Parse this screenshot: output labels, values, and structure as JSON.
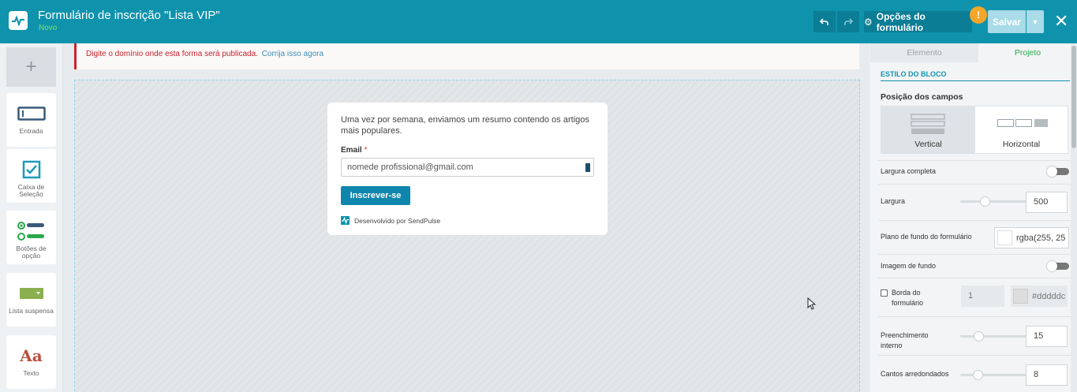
{
  "header": {
    "title": "Formulário de inscrição \"Lista VIP\"",
    "status": "Novo",
    "options_label": "Opções do formulário",
    "save_label": "Salvar"
  },
  "sidebar": {
    "add_label": "+",
    "items": [
      {
        "label": "Entrada",
        "icon": "input-field-icon"
      },
      {
        "label": "Caixa de Seleção",
        "icon": "checkbox-icon"
      },
      {
        "label": "Botões de opção",
        "icon": "radio-buttons-icon"
      },
      {
        "label": "Lista suspensa",
        "icon": "dropdown-list-icon"
      },
      {
        "label": "Texto",
        "icon": "text-icon",
        "glyph": "Aa"
      }
    ]
  },
  "notice": {
    "message": "Digite o domínio onde esta forma será publicada.",
    "link": "Corrija isso agora"
  },
  "form": {
    "description": "Uma vez por semana, enviamos um resumo contendo os artigos mais populares.",
    "email_label": "Email",
    "required_mark": "*",
    "email_placeholder": "nomede profissional@gmail.com",
    "button_label": "Inscrever-se",
    "powered_by": "Desenvolvido por SendPulse"
  },
  "panel": {
    "tabs": [
      "Elemento",
      "Projeto"
    ],
    "active_tab": "Projeto",
    "section_title": "ESTILO DO BLOCO",
    "position_title": "Posição dos campos",
    "position_options": [
      "Vertical",
      "Horizontal"
    ],
    "position_selected": "Vertical",
    "full_width_label": "Largura completa",
    "full_width_on": false,
    "width_label": "Largura",
    "width_value": "500",
    "bg_label": "Plano de fundo do formulário",
    "bg_value": "rgba(255, 25",
    "bg_image_label": "Imagem de fundo",
    "bg_image_on": false,
    "border_label": "Borda do formulário",
    "border_checked": false,
    "border_width": "1",
    "border_color": "#dddddc",
    "padding_label": "Preenchimento interno",
    "padding_value": "15",
    "radius_label": "Cantos arredondados",
    "radius_value": "8"
  },
  "colors": {
    "header_bg": "#0f93ad",
    "accent_green": "#29a84a",
    "error_red": "#c8242d",
    "button_blue": "#0f86ad"
  }
}
